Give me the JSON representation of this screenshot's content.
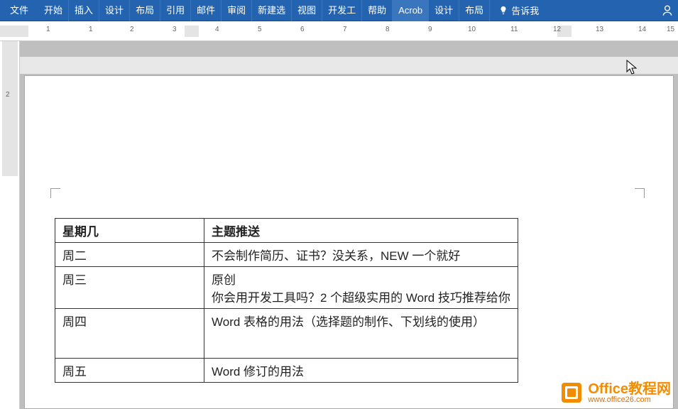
{
  "ribbon": {
    "file": "文件",
    "tabs": [
      "开始",
      "插入",
      "设计",
      "布局",
      "引用",
      "邮件",
      "审阅",
      "新建选",
      "视图",
      "开发工",
      "帮助",
      "Acrob",
      "设计",
      "布局"
    ],
    "active_index": 11,
    "tellme": "告诉我"
  },
  "ruler_h_nums": [
    "1",
    "1",
    "2",
    "3",
    "4",
    "5",
    "6",
    "7",
    "8",
    "9",
    "10",
    "11",
    "12",
    "13",
    "14",
    "15"
  ],
  "ruler_v_nums": [
    "2"
  ],
  "table": {
    "headers": [
      "星期几",
      "主题推送"
    ],
    "rows": [
      {
        "a": "周二",
        "b": "不会制作简历、证书？没关系，NEW 一个就好"
      },
      {
        "a": "周三",
        "b": "原创\n你会用开发工具吗？2 个超级实用的 Word 技巧推荐给你"
      },
      {
        "a": "周四",
        "b": "Word 表格的用法（选择题的制作、下划线的使用）"
      },
      {
        "a": "周五",
        "b": "Word 修订的用法"
      }
    ]
  },
  "watermark": {
    "main": "Office教程网",
    "sub": "www.office26.com"
  }
}
